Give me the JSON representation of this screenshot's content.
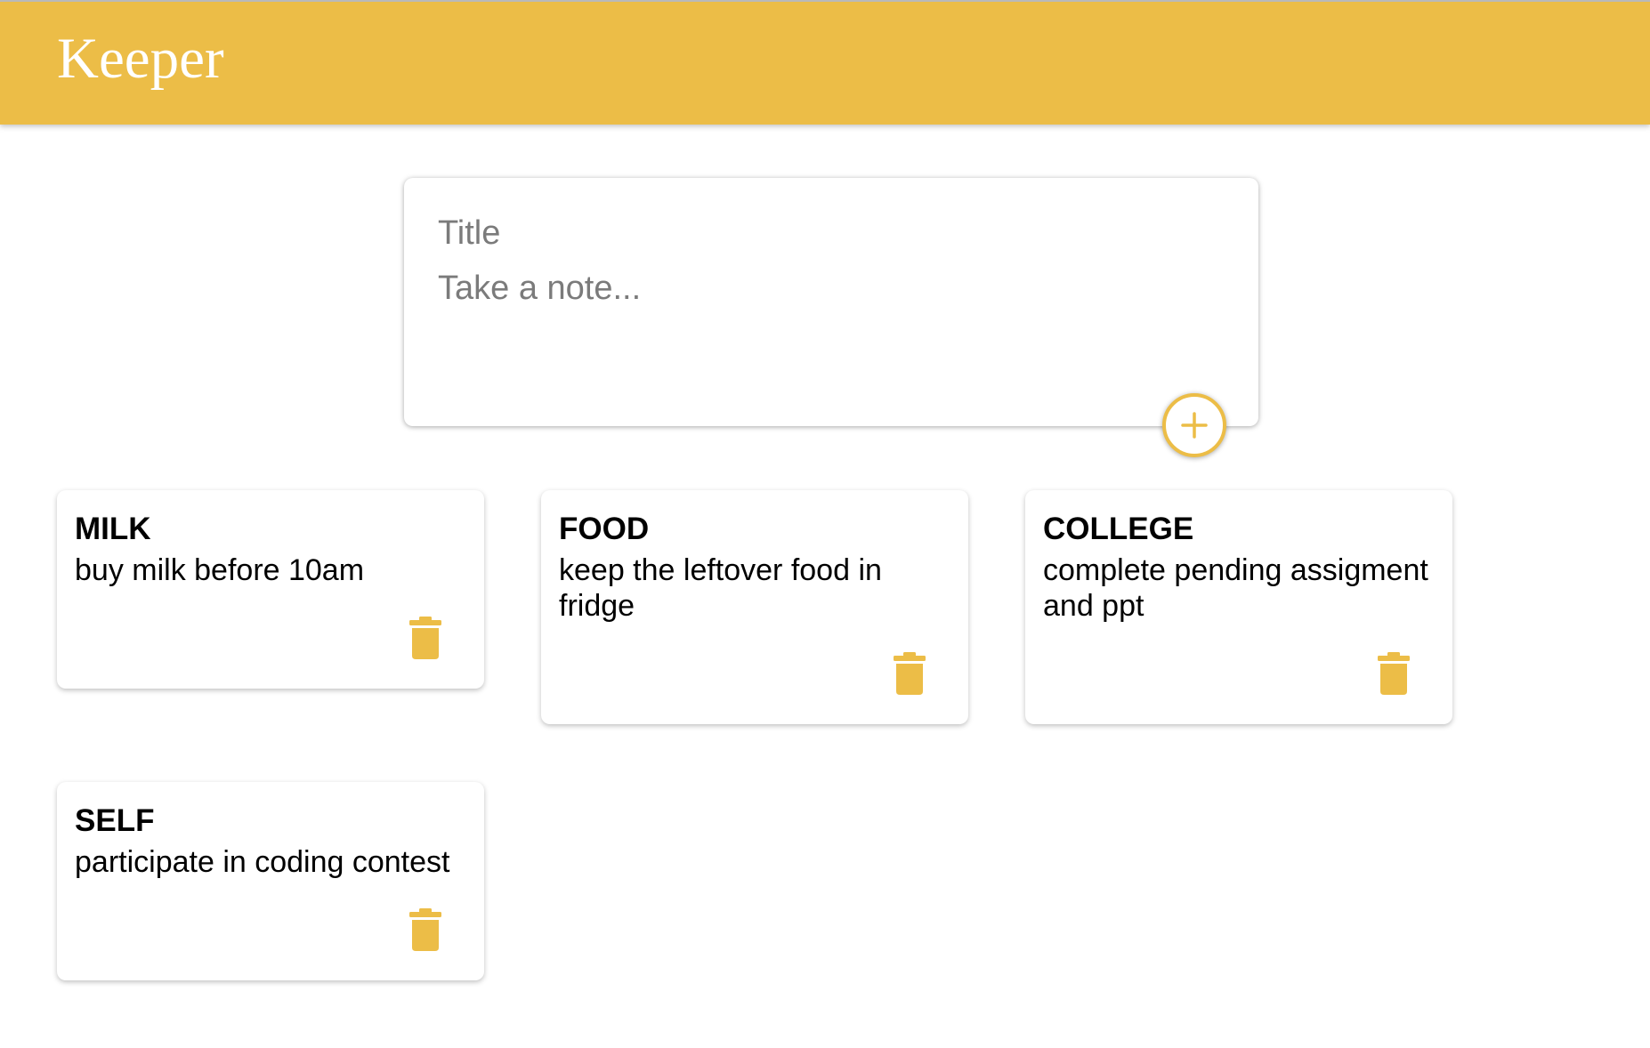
{
  "header": {
    "title": "Keeper"
  },
  "create_note": {
    "title_placeholder": "Title",
    "content_placeholder": "Take a note...",
    "add_button_icon": "plus-icon"
  },
  "notes": [
    {
      "title": "MILK",
      "content": "buy milk before 10am",
      "delete_icon": "trash-icon"
    },
    {
      "title": "FOOD",
      "content": "keep the leftover food in fridge",
      "delete_icon": "trash-icon"
    },
    {
      "title": "COLLEGE",
      "content": "complete pending assigment and ppt",
      "delete_icon": "trash-icon"
    },
    {
      "title": "SELF",
      "content": "participate in coding contest",
      "delete_icon": "trash-icon"
    }
  ],
  "colors": {
    "accent": "#ecbd47",
    "background": "#ffffff",
    "text": "#000000",
    "placeholder": "#7b7b7b"
  }
}
